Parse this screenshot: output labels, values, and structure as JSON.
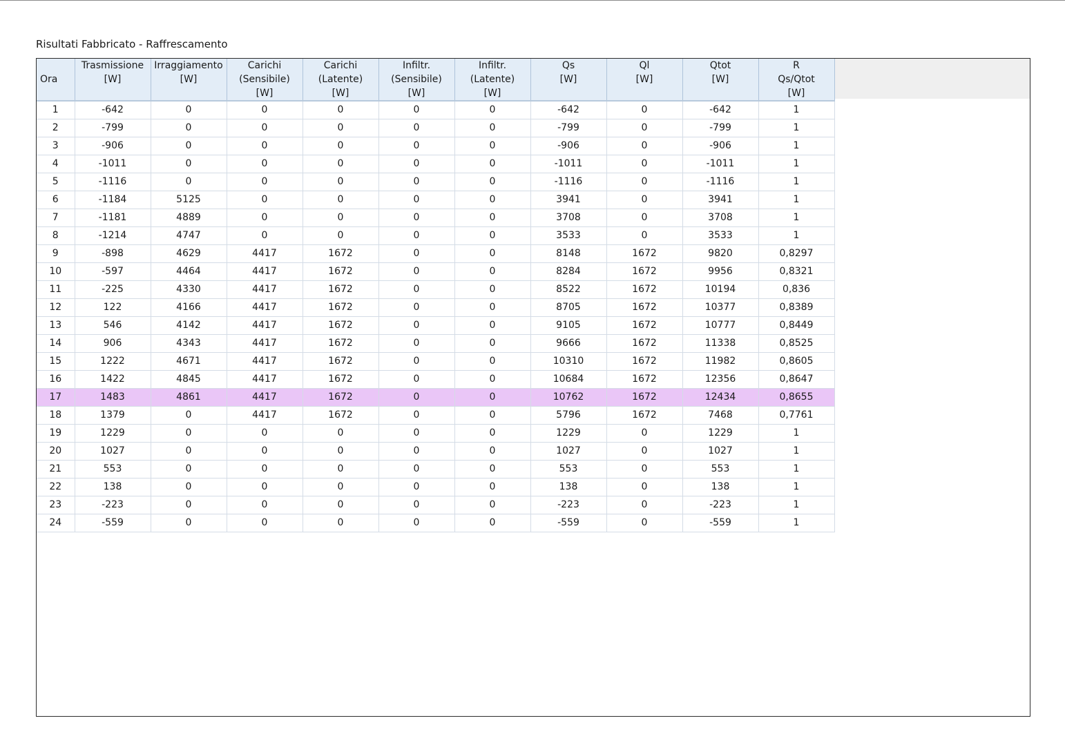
{
  "title": "Risultati Fabbricato - Raffrescamento",
  "columns": [
    {
      "lines": [
        "Ora"
      ]
    },
    {
      "lines": [
        "Trasmissione",
        "[W]"
      ]
    },
    {
      "lines": [
        "Irraggiamento",
        "[W]"
      ]
    },
    {
      "lines": [
        "Carichi",
        "(Sensibile)",
        "[W]"
      ]
    },
    {
      "lines": [
        "Carichi",
        "(Latente)",
        "[W]"
      ]
    },
    {
      "lines": [
        "Infiltr.",
        "(Sensibile)",
        "[W]"
      ]
    },
    {
      "lines": [
        "Infiltr.",
        "(Latente)",
        "[W]"
      ]
    },
    {
      "lines": [
        "Qs",
        "[W]"
      ]
    },
    {
      "lines": [
        "Ql",
        "[W]"
      ]
    },
    {
      "lines": [
        "Qtot",
        "[W]"
      ]
    },
    {
      "lines": [
        "R",
        "Qs/Qtot",
        "[W]"
      ]
    }
  ],
  "selected_row": "17",
  "selected_color": "#eac6f7",
  "rows": [
    [
      "1",
      "-642",
      "0",
      "0",
      "0",
      "0",
      "0",
      "-642",
      "0",
      "-642",
      "1"
    ],
    [
      "2",
      "-799",
      "0",
      "0",
      "0",
      "0",
      "0",
      "-799",
      "0",
      "-799",
      "1"
    ],
    [
      "3",
      "-906",
      "0",
      "0",
      "0",
      "0",
      "0",
      "-906",
      "0",
      "-906",
      "1"
    ],
    [
      "4",
      "-1011",
      "0",
      "0",
      "0",
      "0",
      "0",
      "-1011",
      "0",
      "-1011",
      "1"
    ],
    [
      "5",
      "-1116",
      "0",
      "0",
      "0",
      "0",
      "0",
      "-1116",
      "0",
      "-1116",
      "1"
    ],
    [
      "6",
      "-1184",
      "5125",
      "0",
      "0",
      "0",
      "0",
      "3941",
      "0",
      "3941",
      "1"
    ],
    [
      "7",
      "-1181",
      "4889",
      "0",
      "0",
      "0",
      "0",
      "3708",
      "0",
      "3708",
      "1"
    ],
    [
      "8",
      "-1214",
      "4747",
      "0",
      "0",
      "0",
      "0",
      "3533",
      "0",
      "3533",
      "1"
    ],
    [
      "9",
      "-898",
      "4629",
      "4417",
      "1672",
      "0",
      "0",
      "8148",
      "1672",
      "9820",
      "0,8297"
    ],
    [
      "10",
      "-597",
      "4464",
      "4417",
      "1672",
      "0",
      "0",
      "8284",
      "1672",
      "9956",
      "0,8321"
    ],
    [
      "11",
      "-225",
      "4330",
      "4417",
      "1672",
      "0",
      "0",
      "8522",
      "1672",
      "10194",
      "0,836"
    ],
    [
      "12",
      "122",
      "4166",
      "4417",
      "1672",
      "0",
      "0",
      "8705",
      "1672",
      "10377",
      "0,8389"
    ],
    [
      "13",
      "546",
      "4142",
      "4417",
      "1672",
      "0",
      "0",
      "9105",
      "1672",
      "10777",
      "0,8449"
    ],
    [
      "14",
      "906",
      "4343",
      "4417",
      "1672",
      "0",
      "0",
      "9666",
      "1672",
      "11338",
      "0,8525"
    ],
    [
      "15",
      "1222",
      "4671",
      "4417",
      "1672",
      "0",
      "0",
      "10310",
      "1672",
      "11982",
      "0,8605"
    ],
    [
      "16",
      "1422",
      "4845",
      "4417",
      "1672",
      "0",
      "0",
      "10684",
      "1672",
      "12356",
      "0,8647"
    ],
    [
      "17",
      "1483",
      "4861",
      "4417",
      "1672",
      "0",
      "0",
      "10762",
      "1672",
      "12434",
      "0,8655"
    ],
    [
      "18",
      "1379",
      "0",
      "4417",
      "1672",
      "0",
      "0",
      "5796",
      "1672",
      "7468",
      "0,7761"
    ],
    [
      "19",
      "1229",
      "0",
      "0",
      "0",
      "0",
      "0",
      "1229",
      "0",
      "1229",
      "1"
    ],
    [
      "20",
      "1027",
      "0",
      "0",
      "0",
      "0",
      "0",
      "1027",
      "0",
      "1027",
      "1"
    ],
    [
      "21",
      "553",
      "0",
      "0",
      "0",
      "0",
      "0",
      "553",
      "0",
      "553",
      "1"
    ],
    [
      "22",
      "138",
      "0",
      "0",
      "0",
      "0",
      "0",
      "138",
      "0",
      "138",
      "1"
    ],
    [
      "23",
      "-223",
      "0",
      "0",
      "0",
      "0",
      "0",
      "-223",
      "0",
      "-223",
      "1"
    ],
    [
      "24",
      "-559",
      "0",
      "0",
      "0",
      "0",
      "0",
      "-559",
      "0",
      "-559",
      "1"
    ]
  ]
}
